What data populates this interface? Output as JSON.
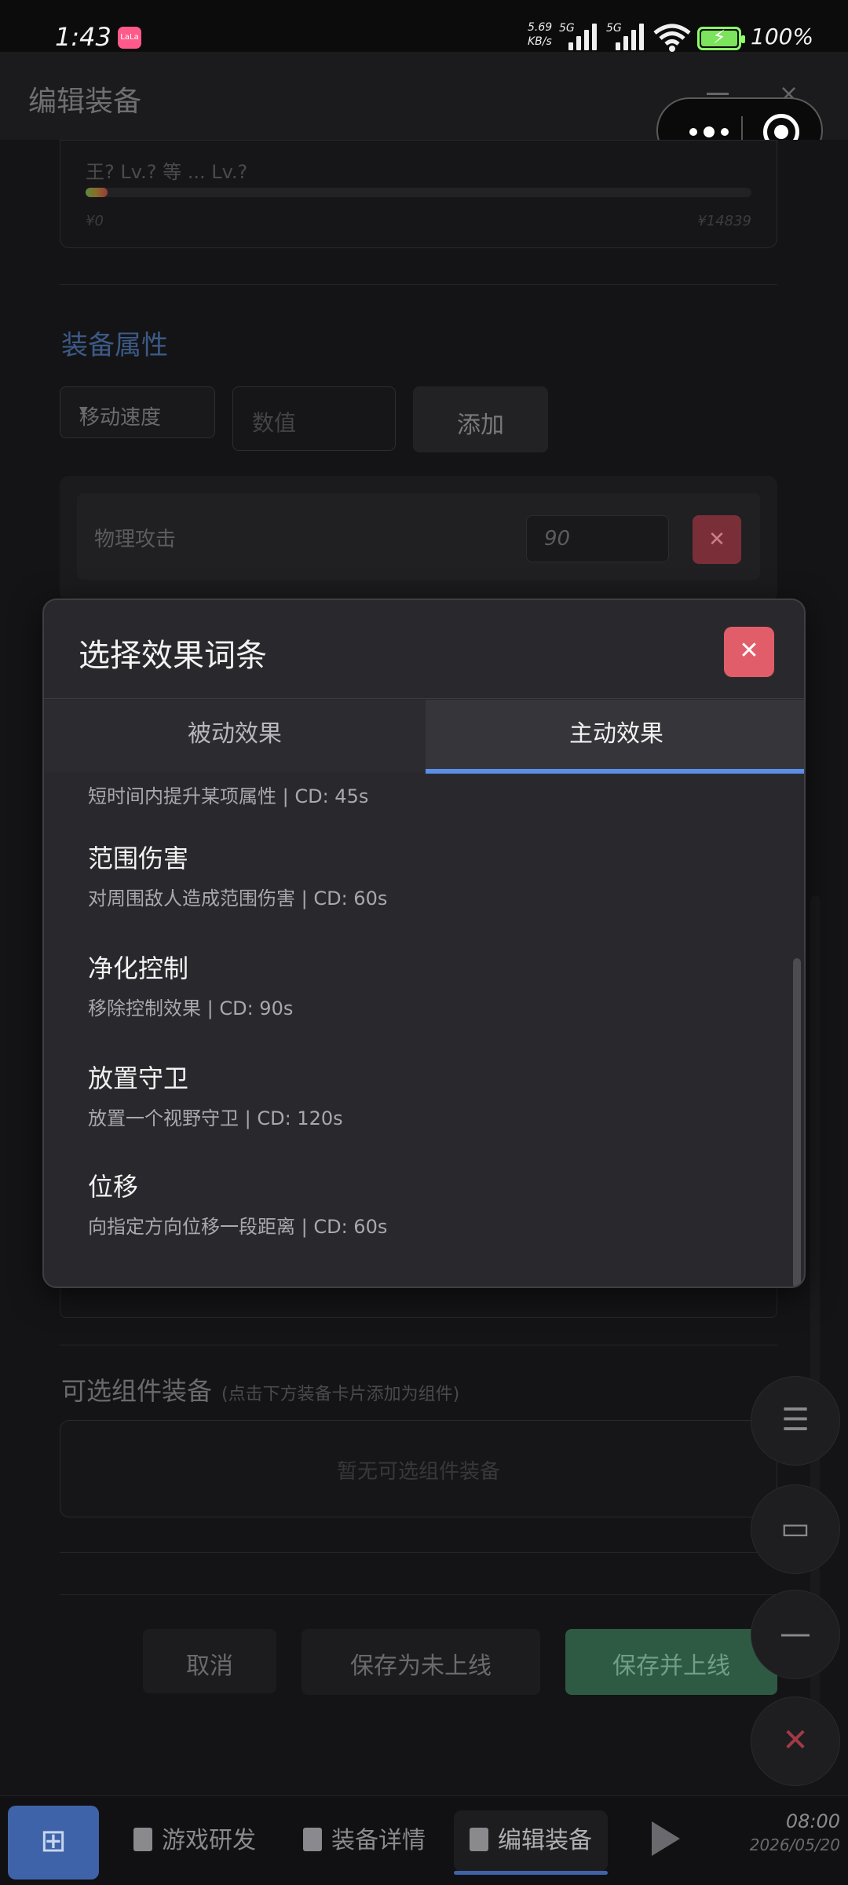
{
  "status_bar": {
    "time": "1:43",
    "net_speed": "5.69",
    "net_unit": "KB/s",
    "signal1": "5G",
    "signal2": "5G",
    "battery": "100%"
  },
  "app_bar": {
    "title": "编辑装备"
  },
  "background": {
    "cut_header_text": "王? Lv.? 等 ... Lv.?",
    "progress_min": "¥0",
    "progress_max": "¥14839",
    "section_title": "装备属性",
    "attr_select": "移动速度",
    "value_placeholder": "数值",
    "add_button": "添加",
    "attr_name": "物理攻击",
    "attr_value": "90",
    "optional_title": "可选组件装备",
    "optional_hint": "(点击下方装备卡片添加为组件)",
    "optional_empty": "暂无可选组件装备",
    "cancel_button": "取消",
    "save_draft_button": "保存为未上线",
    "save_publish_button": "保存并上线"
  },
  "modal": {
    "title": "选择效果词条",
    "tabs": [
      "被动效果",
      "主动效果"
    ],
    "active_tab": 1,
    "cut_item_desc": "短时间内提升某项属性 | CD: 45s",
    "items": [
      {
        "name": "范围伤害",
        "desc": "对周围敌人造成范围伤害 | CD: 60s"
      },
      {
        "name": "净化控制",
        "desc": "移除控制效果 | CD: 90s"
      },
      {
        "name": "放置守卫",
        "desc": "放置一个视野守卫 | CD: 120s"
      },
      {
        "name": "位移",
        "desc": "向指定方向位移一段距离 | CD: 60s"
      }
    ]
  },
  "taskbar": {
    "items": [
      "游戏研发",
      "装备详情",
      "编辑装备"
    ],
    "time": "08:00",
    "date": "2026/05/20"
  },
  "colors": {
    "accent": "#5b8ee6",
    "danger": "#e25d6a",
    "publish": "#2e5a44"
  }
}
